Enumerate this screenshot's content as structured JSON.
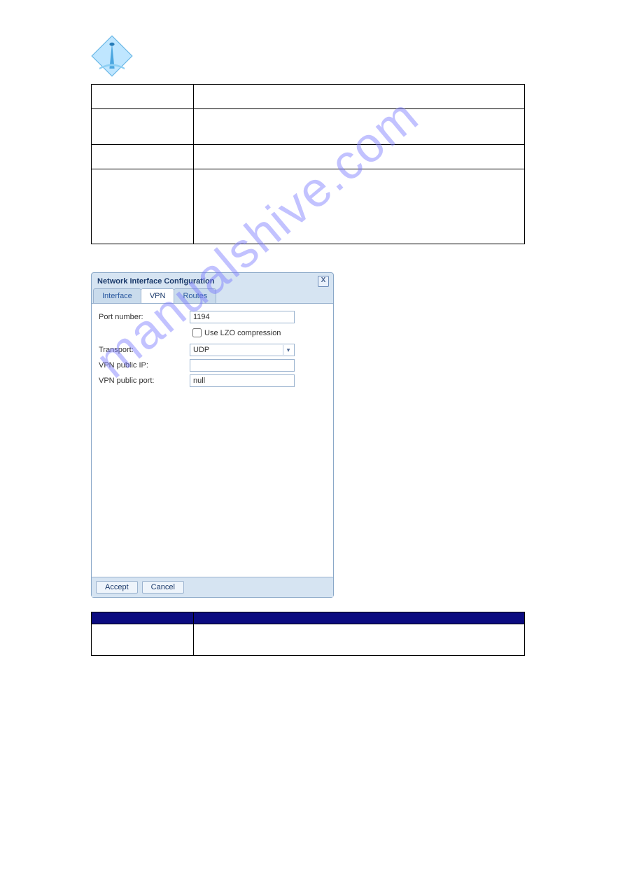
{
  "logo_name": "lighthouse-logo",
  "watermark": "manualshive.com",
  "upper_table": {
    "rows": [
      {
        "param": "",
        "desc": ""
      },
      {
        "param": "",
        "desc": ""
      },
      {
        "param": "",
        "desc": ""
      },
      {
        "param": "",
        "desc": ""
      }
    ]
  },
  "section": {
    "heading_number": "",
    "heading_text": "",
    "intro_text": ""
  },
  "dialog": {
    "title": "Network Interface Configuration",
    "tabs": [
      "Interface",
      "VPN",
      "Routes"
    ],
    "active_tab": "VPN",
    "form": {
      "port_label": "Port number:",
      "port_value": "1194",
      "lzo_label": "Use LZO compression",
      "lzo_checked": false,
      "transport_label": "Transport:",
      "transport_value": "UDP",
      "vpn_ip_label": "VPN public IP:",
      "vpn_ip_value": "",
      "vpn_port_label": "VPN public port:",
      "vpn_port_value": "null"
    },
    "accept_label": "Accept",
    "cancel_label": "Cancel",
    "close_glyph": "X"
  },
  "lower_table": {
    "headers": [
      "",
      ""
    ],
    "rows": [
      {
        "param": "",
        "desc": ""
      }
    ]
  },
  "pager": {
    "page_number": "",
    "doc_title": ""
  }
}
